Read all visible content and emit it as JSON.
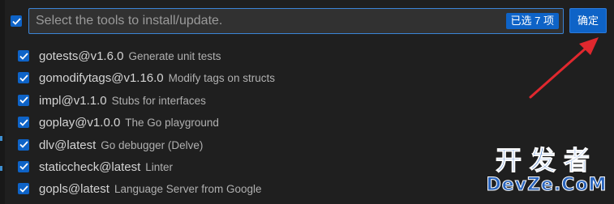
{
  "header": {
    "search_placeholder": "Select the tools to install/update.",
    "selected_count": "已选 7 项",
    "ok_label": "确定",
    "toggle_all_checked": true
  },
  "tools": [
    {
      "name": "gotests@v1.6.0",
      "description": "Generate unit tests",
      "checked": true
    },
    {
      "name": "gomodifytags@v1.16.0",
      "description": "Modify tags on structs",
      "checked": true
    },
    {
      "name": "impl@v1.1.0",
      "description": "Stubs for interfaces",
      "checked": true
    },
    {
      "name": "goplay@v1.0.0",
      "description": "The Go playground",
      "checked": true
    },
    {
      "name": "dlv@latest",
      "description": "Go debugger (Delve)",
      "checked": true
    },
    {
      "name": "staticcheck@latest",
      "description": "Linter",
      "checked": true
    },
    {
      "name": "gopls@latest",
      "description": "Language Server from Google",
      "checked": true
    }
  ],
  "watermark": {
    "line1": "开发者",
    "line2": "DevZe.CoM"
  },
  "colors": {
    "accent": "#0e63c7",
    "annotation_arrow": "#e0282e",
    "background": "#1f1f1f"
  },
  "icons": {
    "checkbox": "check-icon",
    "annotation": "red-arrow-icon"
  }
}
